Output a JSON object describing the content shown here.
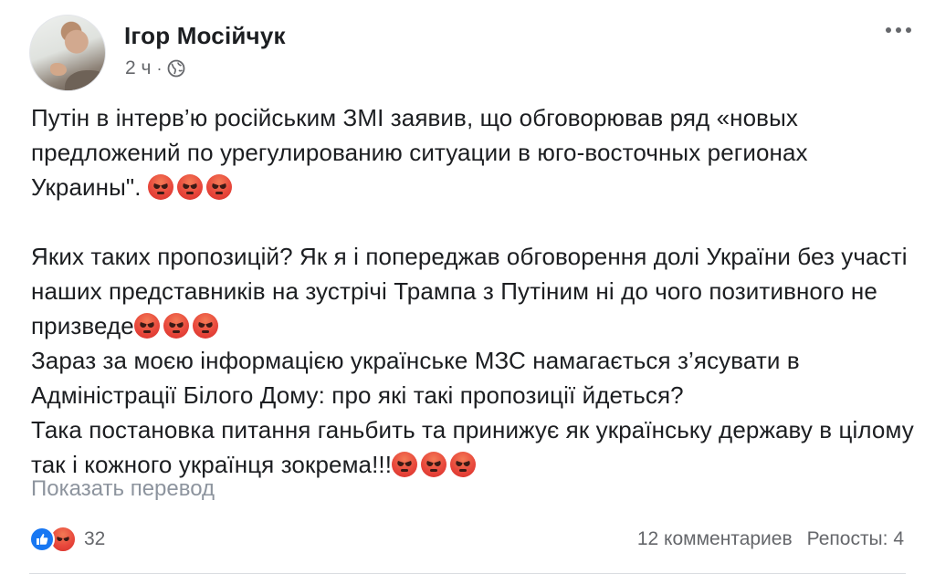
{
  "post": {
    "author": "Ігор Мосійчук",
    "time": "2 ч",
    "separator": "·",
    "audience_icon": "globe-icon",
    "menu_icon": "more-options-icon",
    "paragraph1": {
      "text": "Путін в інтерв’ю російським ЗМІ заявив, що обговорював ряд «новых предложений по урегулированию ситуации в юго-восточных регионах Украины\". ",
      "emoji_count": 3
    },
    "paragraph2": {
      "text": "Яких таких пропозицій? Як я і попереджав обговорення долі України без участі наших представників на зустрічі Трампа з Путіним ні до чого позитивного не призведе",
      "emoji_count": 3
    },
    "paragraph3": {
      "text": "Зараз за моєю інформацією українське МЗС намагається з’ясувати в Адміністрації Білого Дому: про які такі пропозиції йдеться?"
    },
    "paragraph4": {
      "text": "Така постановка питання ганьбить та принижує як українську державу в цілому так і кожного українця зокрема!!!",
      "emoji_count": 3
    },
    "emoji_icon": "angry-face-emoji",
    "translate_label": "Показать перевод"
  },
  "footer": {
    "reaction_icons": [
      "like-icon",
      "angry-icon"
    ],
    "reaction_count": "32",
    "comments": "12 комментариев",
    "shares": "Репосты: 4"
  },
  "colors": {
    "text": "#1c1e21",
    "secondary": "#65676b",
    "muted": "#8d949e",
    "like_blue": "#1877f2",
    "angry_red": "#e8483c"
  }
}
